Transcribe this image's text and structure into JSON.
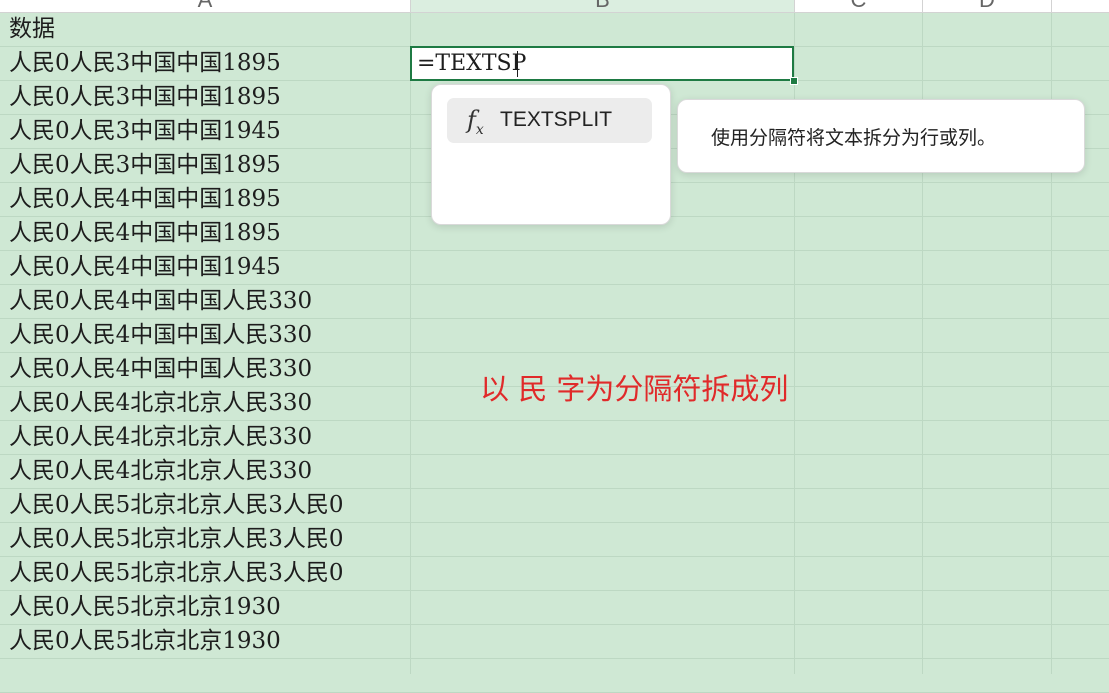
{
  "columns": [
    {
      "letter": "A",
      "selected": false
    },
    {
      "letter": "B",
      "selected": true
    },
    {
      "letter": "C",
      "selected": false
    },
    {
      "letter": "D",
      "selected": false
    }
  ],
  "column_a": [
    "数据",
    "人民0人民3中国中国1895",
    "人民0人民3中国中国1895",
    "人民0人民3中国中国1945",
    "人民0人民3中国中国1895",
    "人民0人民4中国中国1895",
    "人民0人民4中国中国1895",
    "人民0人民4中国中国1945",
    "人民0人民4中国中国人民330",
    "人民0人民4中国中国人民330",
    "人民0人民4中国中国人民330",
    "人民0人民4北京北京人民330",
    "人民0人民4北京北京人民330",
    "人民0人民4北京北京人民330",
    "人民0人民5北京北京人民3人民0",
    "人民0人民5北京北京人民3人民0",
    "人民0人民5北京北京人民3人民0",
    "人民0人民5北京北京1930",
    "人民0人民5北京北京1930",
    ""
  ],
  "active_cell": {
    "value": "=TEXTSP"
  },
  "autocomplete": {
    "icon": "function-fx-icon",
    "items": [
      {
        "name": "TEXTSPLIT"
      }
    ]
  },
  "tooltip": {
    "text": "使用分隔符将文本拆分为行或列。"
  },
  "annotation": {
    "text": "以 民 字为分隔符拆成列",
    "color": "#e02a2a"
  },
  "colors": {
    "sheet_bg": "#cfe8d4",
    "accent": "#1e7a43"
  }
}
